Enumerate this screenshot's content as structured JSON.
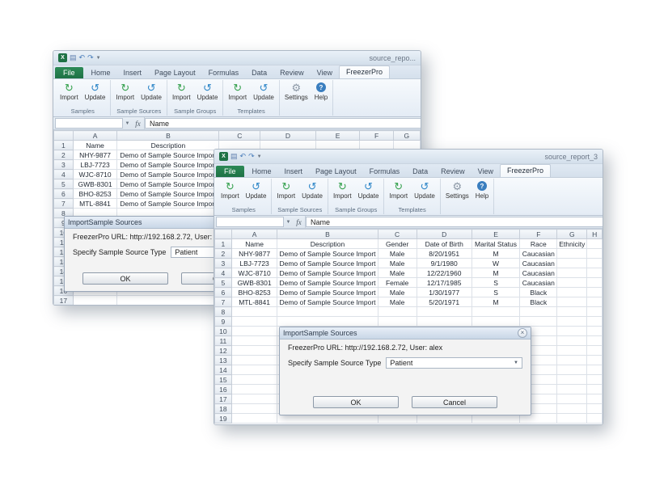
{
  "windows": {
    "back": {
      "title": "source_repo...",
      "sheet": {
        "columns": [
          "A",
          "B",
          "C",
          "D",
          "E",
          "F",
          "G"
        ],
        "row_count": 17,
        "cells": [
          [
            "Name",
            "Description",
            "",
            "",
            "",
            "",
            ""
          ],
          [
            "NHY-9877",
            "Demo of Sample Source Import",
            "",
            "",
            "",
            "",
            ""
          ],
          [
            "LBJ-7723",
            "Demo of Sample Source Import",
            "",
            "",
            "",
            "",
            ""
          ],
          [
            "WJC-8710",
            "Demo of Sample Source Import",
            "",
            "",
            "",
            "",
            ""
          ],
          [
            "GWB-8301",
            "Demo of Sample Source Import",
            "",
            "",
            "",
            "",
            ""
          ],
          [
            "BHO-8253",
            "Demo of Sample Source Import",
            "",
            "",
            "",
            "",
            ""
          ],
          [
            "MTL-8841",
            "Demo of Sample Source Import",
            "",
            "",
            "",
            "",
            ""
          ]
        ]
      }
    },
    "front": {
      "title": "source_report_3",
      "sheet": {
        "columns": [
          "A",
          "B",
          "C",
          "D",
          "E",
          "F",
          "G",
          "H"
        ],
        "row_count": 19,
        "cells": [
          [
            "Name",
            "Description",
            "Gender",
            "Date of Birth",
            "Marital Status",
            "Race",
            "Ethnicity",
            ""
          ],
          [
            "NHY-9877",
            "Demo of Sample Source Import",
            "Male",
            "8/20/1951",
            "M",
            "Caucasian",
            "",
            ""
          ],
          [
            "LBJ-7723",
            "Demo of Sample Source Import",
            "Male",
            "9/1/1980",
            "W",
            "Caucasian",
            "",
            ""
          ],
          [
            "WJC-8710",
            "Demo of Sample Source Import",
            "Male",
            "12/22/1960",
            "M",
            "Caucasian",
            "",
            ""
          ],
          [
            "GWB-8301",
            "Demo of Sample Source Import",
            "Female",
            "12/17/1985",
            "S",
            "Caucasian",
            "",
            ""
          ],
          [
            "BHO-8253",
            "Demo of Sample Source Import",
            "Male",
            "1/30/1977",
            "S",
            "Black",
            "",
            ""
          ],
          [
            "MTL-8841",
            "Demo of Sample Source Import",
            "Male",
            "5/20/1971",
            "M",
            "Black",
            "",
            ""
          ]
        ]
      }
    }
  },
  "ribbon": {
    "file_tab": "File",
    "tabs": [
      "Home",
      "Insert",
      "Page Layout",
      "Formulas",
      "Data",
      "Review",
      "View",
      "FreezerPro"
    ],
    "active_tab": "FreezerPro",
    "groups": [
      {
        "label": "Samples",
        "buttons": [
          "Import",
          "Update"
        ]
      },
      {
        "label": "Sample Sources",
        "buttons": [
          "Import",
          "Update"
        ]
      },
      {
        "label": "Sample Groups",
        "buttons": [
          "Import",
          "Update"
        ]
      },
      {
        "label": "Templates",
        "buttons": [
          "Import",
          "Update"
        ]
      }
    ],
    "standalone_buttons": [
      {
        "label": "Settings",
        "icon": "gear-icon"
      },
      {
        "label": "Help",
        "icon": "help-icon"
      }
    ]
  },
  "formula_bar": {
    "name_box": "",
    "fx_label": "fx",
    "cell_value": "Name"
  },
  "dialog": {
    "title": "ImportSample Sources",
    "url_line": "FreezerPro URL:  http://192.168.2.72, User: alex",
    "type_label": "Specify Sample Source Type",
    "type_value": "Patient",
    "ok_label": "OK",
    "cancel_label": "Cancel",
    "close_icon": "×"
  },
  "colors": {
    "file_tab_green": "#1e7145",
    "help_blue": "#3a7ebf",
    "import_icon_green": "#34a04c",
    "update_icon_blue": "#2f87c8"
  }
}
